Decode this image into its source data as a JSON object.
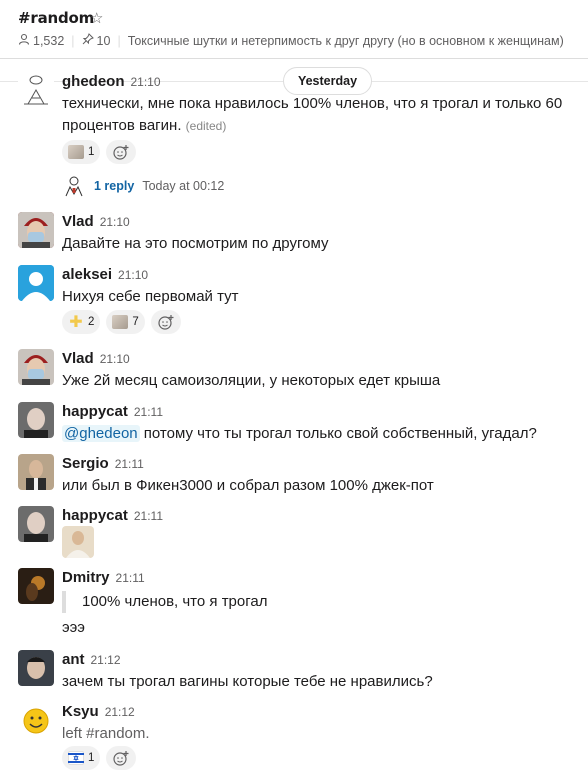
{
  "channel": {
    "title": "#random",
    "star_icon": "star-icon",
    "members": "1,532",
    "pins": "10",
    "topic": "Токсичные шутки и нетерпимость к друг другу (но в основном к женщинам)"
  },
  "day_divider": "Yesterday",
  "messages": [
    {
      "author": "ghedeon",
      "time": "21:10",
      "text": "технически, мне пока нравилось 100% членов, что я трогал и только 60 процентов вагин.",
      "edited": "(edited)",
      "reactions": [
        {
          "emoji": "cat-photo-emoji",
          "count": "1"
        }
      ],
      "thread": {
        "replies": "1 reply",
        "time": "Today at 00:12"
      }
    },
    {
      "author": "Vlad",
      "time": "21:10",
      "text": "Давайте на это посмотрим по другому"
    },
    {
      "author": "aleksei",
      "time": "21:10",
      "text": "Нихуя себе первомай тут",
      "reactions": [
        {
          "emoji": "sparkle-emoji",
          "count": "2"
        },
        {
          "emoji": "cat-photo-emoji",
          "count": "7"
        }
      ]
    },
    {
      "author": "Vlad",
      "time": "21:10",
      "text": "Уже 2й месяц самоизоляции, у некоторых едет крыша"
    },
    {
      "author": "happycat",
      "time": "21:11",
      "mention": "@ghedeon",
      "text": " потому что ты трогал только свой собственный, угадал?"
    },
    {
      "author": "Sergio",
      "time": "21:11",
      "text": "или был в Фикен3000 и собрал разом 100% джек-пот"
    },
    {
      "author": "happycat",
      "time": "21:11",
      "attachment": "image-thumbnail"
    },
    {
      "author": "Dmitry",
      "time": "21:11",
      "quote": "100% членов, что я трогал",
      "text": "эээ"
    },
    {
      "author": "ant",
      "time": "21:12",
      "text": "зачем ты трогал вагины которые тебе не нравились?"
    },
    {
      "author": "Ksyu",
      "time": "21:12",
      "text": "left #random.",
      "reactions": [
        {
          "emoji": "israel-flag-emoji",
          "count": "1"
        }
      ]
    }
  ],
  "colors": {
    "link": "#1264a3",
    "muted": "#616061",
    "reaction_bg": "#f1f1f1"
  }
}
